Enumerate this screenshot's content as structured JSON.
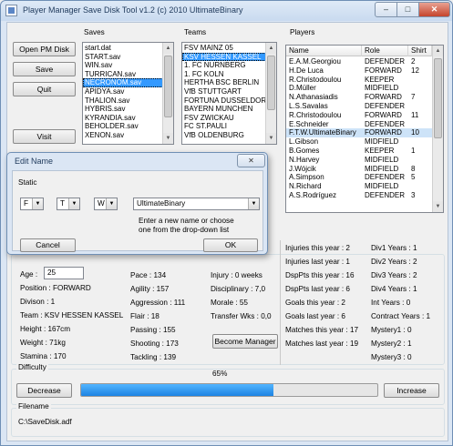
{
  "window": {
    "title": "Player Manager Save Disk Tool v1.2 (c) 2010 UltimateBinary",
    "min_glyph": "–",
    "max_glyph": "□",
    "close_glyph": "✕"
  },
  "buttons": {
    "open": "Open PM Disk",
    "save": "Save",
    "quit": "Quit",
    "visit": "Visit"
  },
  "saves": {
    "label": "Saves",
    "items": [
      "start.dat",
      "START.sav",
      "WIN.sav",
      "TURRICAN.sav",
      "NECRONOM.sav",
      "APIDYA.sav",
      "THALION.sav",
      "HYBRIS.sav",
      "KYRANDIA.sav",
      "BEHOLDER.sav",
      "XENON.sav"
    ],
    "selected_index": 4
  },
  "teams": {
    "label": "Teams",
    "items": [
      "FSV MAINZ 05",
      "KSV HESSEN KASSEL",
      "1. FC NURNBERG",
      "1. FC KOLN",
      "HERTHA BSC BERLIN",
      "VfB STUTTGART",
      "FORTUNA DUSSELDORF",
      "BAYERN MUNCHEN",
      "FSV ZWICKAU",
      "FC ST.PAULI",
      "VfB OLDENBURG"
    ],
    "selected_index": 1
  },
  "players": {
    "label": "Players",
    "columns": [
      "Name",
      "Role",
      "Shirt"
    ],
    "rows": [
      [
        "E.A.M.Georgiou",
        "DEFENDER",
        "2"
      ],
      [
        "H.De Luca",
        "FORWARD",
        "12"
      ],
      [
        "R.Christodoulou",
        "KEEPER",
        ""
      ],
      [
        "D.Müller",
        "MIDFIELD",
        ""
      ],
      [
        "N.Athanasiadis",
        "FORWARD",
        "7"
      ],
      [
        "L.S.Savalas",
        "DEFENDER",
        ""
      ],
      [
        "R.Christodoulou",
        "FORWARD",
        "11"
      ],
      [
        "E.Schneider",
        "DEFENDER",
        ""
      ],
      [
        "F.T.W.UltimateBinary",
        "FORWARD",
        "10"
      ],
      [
        "L.Gibson",
        "MIDFIELD",
        ""
      ],
      [
        "B.Gomes",
        "KEEPER",
        "1"
      ],
      [
        "N.Harvey",
        "MIDFIELD",
        ""
      ],
      [
        "J.Wójcik",
        "MIDFIELD",
        "8"
      ],
      [
        "A.Simpson",
        "DEFENDER",
        "5"
      ],
      [
        "N.Richard",
        "MIDFIELD",
        ""
      ],
      [
        "A.S.Rodríguez",
        "DEFENDER",
        "3"
      ]
    ],
    "selected_index": 8
  },
  "dialog": {
    "title": "Edit Name",
    "close_glyph": "✕",
    "static_label": "Static",
    "combo1": "F",
    "combo2": "T",
    "combo3": "W",
    "name_combo": "UltimateBinary",
    "hint_line1": "Enter a new name or choose",
    "hint_line2": "one from the drop-down list",
    "cancel": "Cancel",
    "ok": "OK"
  },
  "details": {
    "age_label": "Age :",
    "age_value": "25",
    "position": "Position : FORWARD",
    "division": "Divison : 1",
    "team": "Team : KSV HESSEN KASSEL",
    "height": "Height : 167cm",
    "weight": "Weight : 71kg",
    "stamina": "Stamina : 170",
    "pace": "Pace : 134",
    "agility": "Agility : 157",
    "aggression": "Aggression : 111",
    "flair": "Flair : 18",
    "passing": "Passing : 155",
    "shooting": "Shooting : 173",
    "tackling": "Tackling : 139",
    "injury": "Injury : 0 weeks",
    "discipline": "Disciplinary : 7,0",
    "morale": "Morale : 55",
    "transfer": "Transfer Wks : 0,0",
    "become_manager": "Become Manager",
    "injuries_this_year": "Injuries this year : 2",
    "injuries_last_year": "Injuries last year : 1",
    "dsp_this": "DspPts this year : 16",
    "dsp_last": "DspPts last year : 6",
    "goals_this": "Goals this year : 2",
    "goals_last": "Goals last year : 6",
    "matches_this": "Matches this year : 17",
    "matches_last": "Matches last year : 19",
    "div1": "Div1 Years : 1",
    "div2": "Div2 Years : 2",
    "div3": "Div3 Years : 2",
    "div4": "Div4 Years : 1",
    "int_years": "Int Years : 0",
    "contract": "Contract Years : 1",
    "mystery1": "Mystery1 : 0",
    "mystery2": "Mystery2 : 1",
    "mystery3": "Mystery3 : 0"
  },
  "difficulty": {
    "label": "Difficulty",
    "percent_label": "65%",
    "value": 0.65,
    "decrease": "Decrease",
    "increase": "Increase"
  },
  "filename": {
    "label": "Filename",
    "value": "C:\\SaveDisk.adf"
  },
  "colors": {
    "selection": "#3399ff",
    "row_selection": "#cde3f8",
    "progress": "#1d83e2"
  }
}
